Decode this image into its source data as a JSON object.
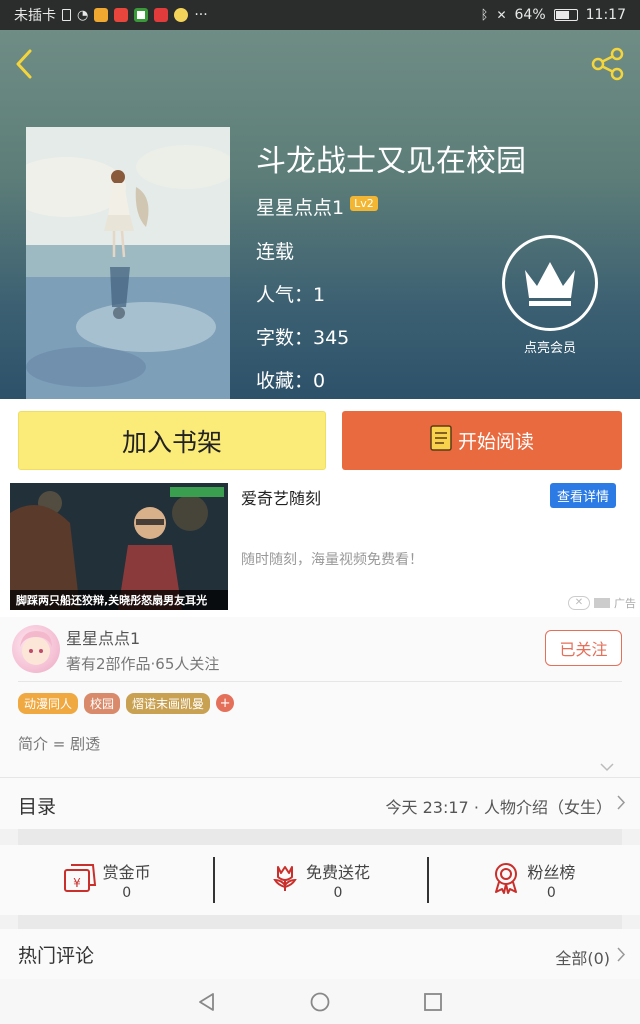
{
  "status_bar": {
    "carrier": "未插卡",
    "battery": "64%",
    "time": "11:17",
    "more": "···"
  },
  "book": {
    "title": "斗龙战士又见在校园",
    "author": "星星点点1",
    "level": "Lv2",
    "status": "连载",
    "popularity": "人气：1",
    "word_count": "字数：345",
    "favorites": "收藏：0"
  },
  "vip": {
    "label": "点亮会员"
  },
  "actions": {
    "add_shelf": "加入书架",
    "start_reading": "开始阅读"
  },
  "ad": {
    "title": "爱奇艺随刻",
    "detail_button": "查看详情",
    "description": "随时随刻，海量视频免费看！",
    "caption": "脚踩两只船还狡辩,关晓彤怒扇男友耳光",
    "tag": "广告"
  },
  "author_card": {
    "name": "星星点点1",
    "stats": "著有2部作品·65人关注",
    "follow": "已关注",
    "tags": [
      {
        "label": "动漫同人",
        "color": "#f0a840"
      },
      {
        "label": "校园",
        "color": "#d98a6a"
      },
      {
        "label": "熠诺末画凯曼",
        "color": "#c9a152"
      }
    ],
    "add_tag": "+",
    "intro": "简介 = 剧透"
  },
  "toc": {
    "label": "目录",
    "latest": "今天 23:17 · 人物介绍（女生）"
  },
  "rewards": [
    {
      "label": "赏金币",
      "count": "0",
      "icon": "coin-envelope-icon"
    },
    {
      "label": "免费送花",
      "count": "0",
      "icon": "flower-icon"
    },
    {
      "label": "粉丝榜",
      "count": "0",
      "icon": "medal-icon"
    }
  ],
  "comments": {
    "label": "热门评论",
    "all": "全部(0)"
  },
  "colors": {
    "accent_orange": "#ea6a3f",
    "shelf_yellow": "#fbeb78",
    "link_blue": "#2c7be5"
  }
}
